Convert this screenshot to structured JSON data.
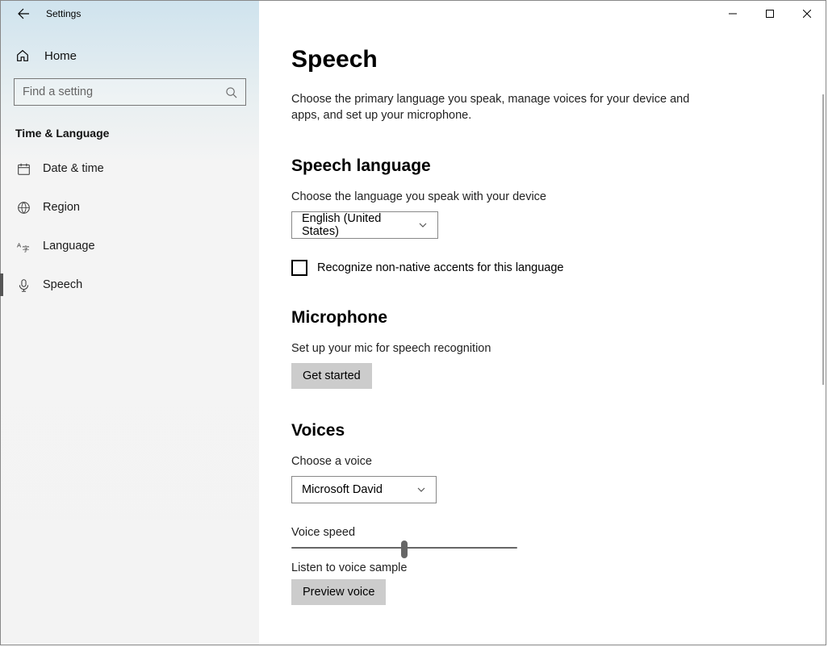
{
  "app_title": "Settings",
  "sidebar": {
    "home_label": "Home",
    "search_placeholder": "Find a setting",
    "category_heading": "Time & Language",
    "items": [
      {
        "label": "Date & time"
      },
      {
        "label": "Region"
      },
      {
        "label": "Language"
      },
      {
        "label": "Speech"
      }
    ]
  },
  "main": {
    "title": "Speech",
    "intro": "Choose the primary language you speak, manage voices for your device and apps, and set up your microphone.",
    "speech_language": {
      "heading": "Speech language",
      "description": "Choose the language you speak with your device",
      "selected": "English (United States)",
      "checkbox_label": "Recognize non-native accents for this language",
      "checkbox_checked": false
    },
    "microphone": {
      "heading": "Microphone",
      "description": "Set up your mic for speech recognition",
      "button": "Get started"
    },
    "voices": {
      "heading": "Voices",
      "choose_label": "Choose a voice",
      "selected_voice": "Microsoft David",
      "speed_label": "Voice speed",
      "speed_percent": 50,
      "sample_label": "Listen to voice sample",
      "preview_button": "Preview voice"
    }
  }
}
